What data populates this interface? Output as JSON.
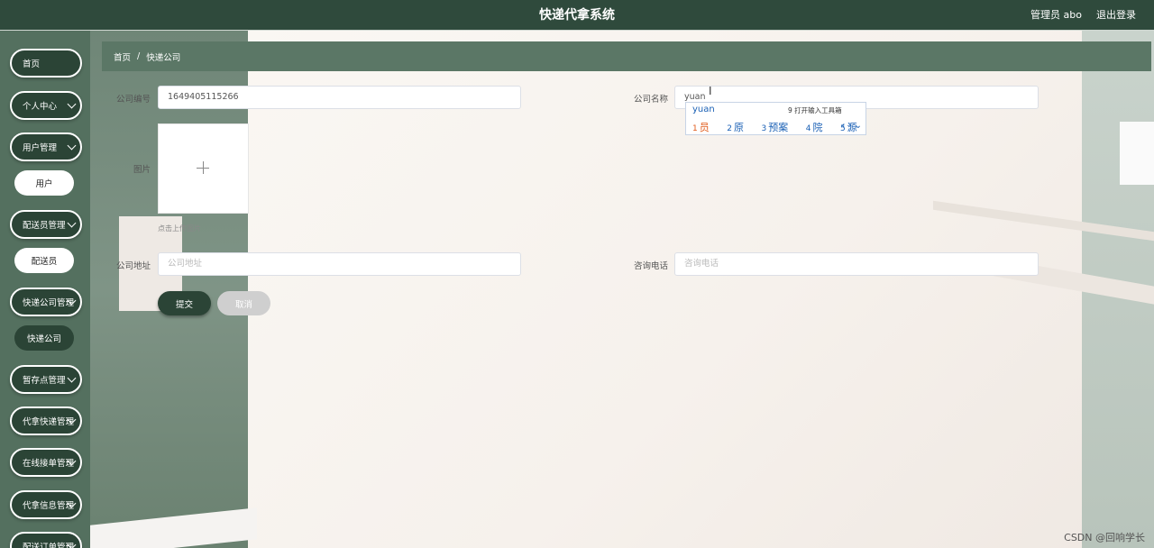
{
  "header": {
    "title": "快递代拿系统",
    "user_label": "管理员 abo",
    "logout": "退出登录"
  },
  "sidebar": {
    "items": [
      {
        "label": "首页"
      },
      {
        "label": "个人中心"
      },
      {
        "label": "用户管理"
      },
      {
        "label": "用户"
      },
      {
        "label": "配送员管理"
      },
      {
        "label": "配送员"
      },
      {
        "label": "快递公司管理"
      },
      {
        "label": "快递公司"
      },
      {
        "label": "暂存点管理"
      },
      {
        "label": "代拿快递管理"
      },
      {
        "label": "在线接单管理"
      },
      {
        "label": "代拿信息管理"
      },
      {
        "label": "配送订单管理"
      }
    ]
  },
  "breadcrumb": {
    "home": "首页",
    "separator": "/",
    "current": "快递公司"
  },
  "form": {
    "company_no_label": "公司编号",
    "company_no_value": "1649405115266",
    "company_name_label": "公司名称",
    "company_name_value": "yuan",
    "image_label": "图片",
    "upload_hint": "点击上传图片",
    "address_label": "公司地址",
    "address_placeholder": "公司地址",
    "phone_label": "咨询电话",
    "phone_placeholder": "咨询电话",
    "submit": "提交",
    "cancel": "取消"
  },
  "ime": {
    "composition": "yuan",
    "tip": "9 打开输入工具箱",
    "candidates": [
      {
        "num": "1",
        "text": "员"
      },
      {
        "num": "2",
        "text": "原"
      },
      {
        "num": "3",
        "text": "预案"
      },
      {
        "num": "4",
        "text": "院"
      },
      {
        "num": "5",
        "text": "源"
      }
    ],
    "nav": "‹ › ⌄"
  },
  "watermark": "CSDN @回响学长",
  "colors": {
    "primary_dark": "#2b4436",
    "topbar": "#2f4a3c",
    "sidebar": "#54705f",
    "breadcrumb": "#5b7766"
  }
}
